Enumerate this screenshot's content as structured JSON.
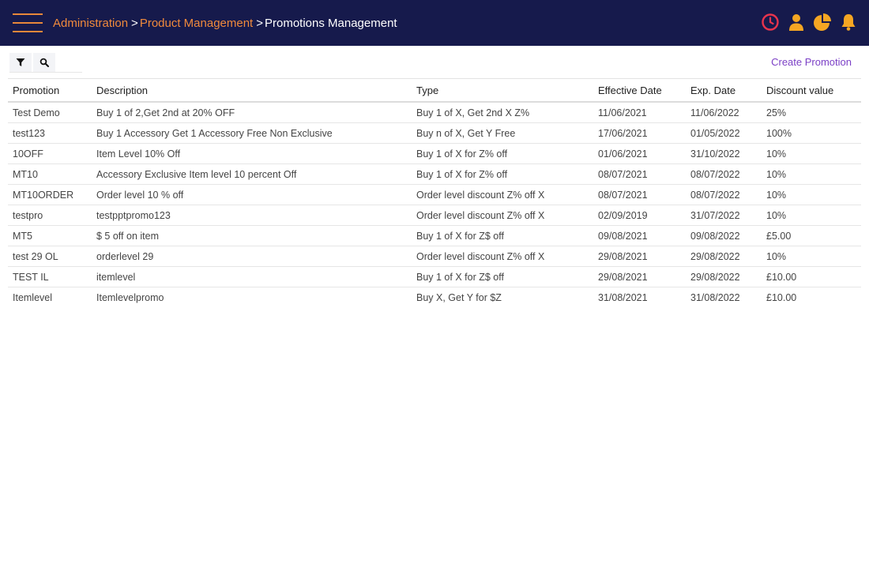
{
  "header": {
    "breadcrumb": [
      {
        "label": "Administration",
        "link": true
      },
      {
        "label": "Product Management",
        "link": true
      },
      {
        "label": "Promotions Management",
        "link": false
      }
    ],
    "separator": ">",
    "icons": [
      "clock-icon",
      "user-icon",
      "pie-chart-icon",
      "bell-icon"
    ],
    "colors": {
      "bar": "#161a4c",
      "accent": "#f08a3c",
      "clock": "#e8344d",
      "user_icons": "#f5a623"
    }
  },
  "toolbar": {
    "filter_icon": "filter-icon",
    "search_icon": "search-icon"
  },
  "create_promotion_label": "Create Promotion",
  "table": {
    "columns": [
      "Promotion",
      "Description",
      "Type",
      "Effective Date",
      "Exp. Date",
      "Discount value"
    ],
    "rows": [
      {
        "promotion": "Test Demo",
        "description": "Buy 1 of 2,Get 2nd at 20% OFF",
        "type": "Buy 1 of X, Get 2nd X Z%",
        "effective": "11/06/2021",
        "exp": "11/06/2022",
        "discount": "25%",
        "kind": "pct"
      },
      {
        "promotion": "test123",
        "description": "Buy 1 Accessory Get 1 Accessory Free Non Exclusive",
        "type": "Buy n of X, Get Y Free",
        "effective": "17/06/2021",
        "exp": "01/05/2022",
        "discount": "100%",
        "kind": "pct"
      },
      {
        "promotion": "10OFF",
        "description": "Item Level 10% Off",
        "type": "Buy 1 of X for Z% off",
        "effective": "01/06/2021",
        "exp": "31/10/2022",
        "discount": "10%",
        "kind": "pct"
      },
      {
        "promotion": "MT10",
        "description": "Accessory Exclusive Item level 10 percent Off",
        "type": "Buy 1 of X for Z% off",
        "effective": "08/07/2021",
        "exp": "08/07/2022",
        "discount": "10%",
        "kind": "pct"
      },
      {
        "promotion": "MT10ORDER",
        "description": "Order level 10 % off",
        "type": "Order level discount Z% off X",
        "effective": "08/07/2021",
        "exp": "08/07/2022",
        "discount": "10%",
        "kind": "pct"
      },
      {
        "promotion": "testpro",
        "description": "testpptpromo123",
        "type": "Order level discount Z% off X",
        "effective": "02/09/2019",
        "exp": "31/07/2022",
        "discount": "10%",
        "kind": "pct"
      },
      {
        "promotion": "MT5",
        "description": "$ 5 off on item",
        "type": "Buy 1 of X for Z$ off",
        "effective": "09/08/2021",
        "exp": "09/08/2022",
        "discount": "£5.00",
        "kind": "amt"
      },
      {
        "promotion": "test 29 OL",
        "description": "orderlevel 29",
        "type": "Order level discount Z% off X",
        "effective": "29/08/2021",
        "exp": "29/08/2022",
        "discount": "10%",
        "kind": "pct"
      },
      {
        "promotion": "TEST IL",
        "description": "itemlevel",
        "type": "Buy 1 of X for Z$ off",
        "effective": "29/08/2021",
        "exp": "29/08/2022",
        "discount": "£10.00",
        "kind": "amt"
      },
      {
        "promotion": "Itemlevel",
        "description": "Itemlevelpromo",
        "type": "Buy X, Get Y for $Z",
        "effective": "31/08/2021",
        "exp": "31/08/2022",
        "discount": "£10.00",
        "kind": "amt"
      }
    ]
  }
}
